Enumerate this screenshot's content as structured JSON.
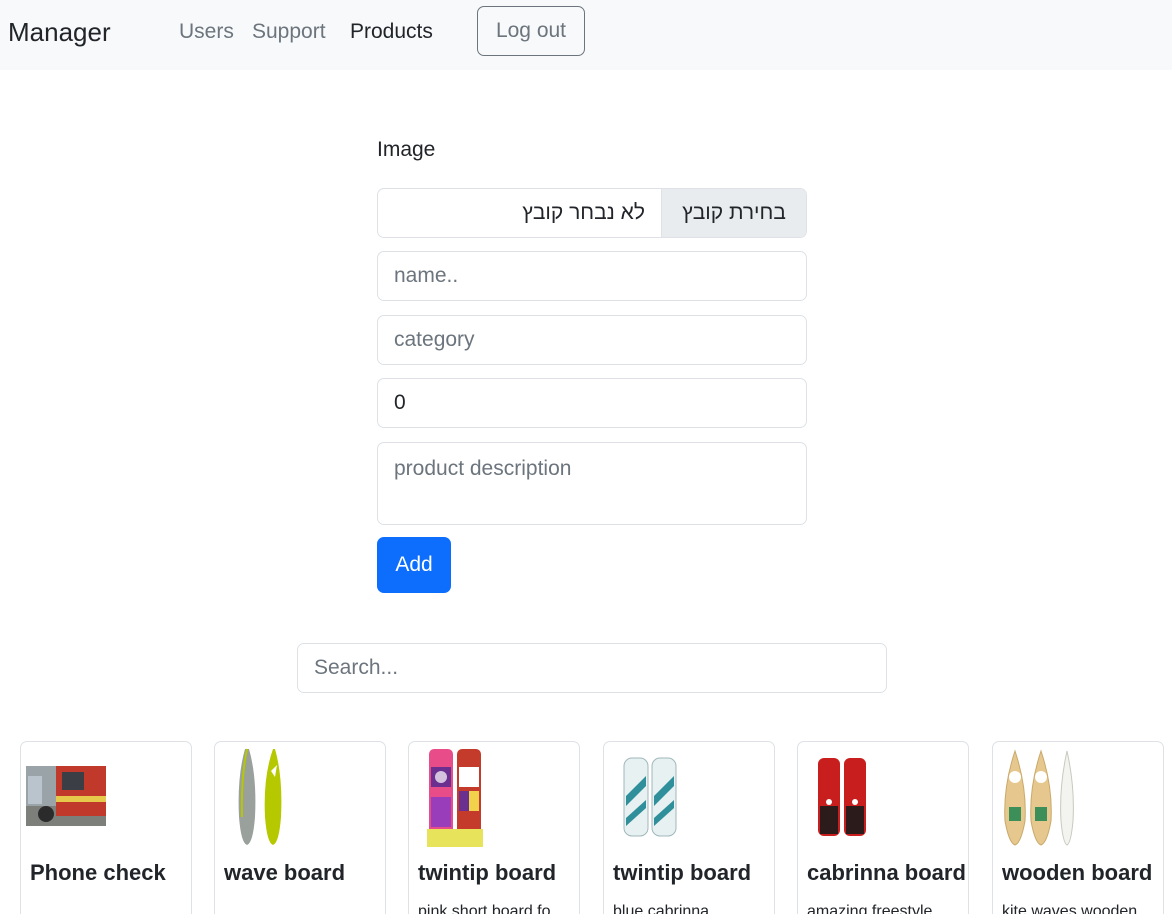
{
  "navbar": {
    "brand": "Manager",
    "links": [
      {
        "label": "Users",
        "active": false
      },
      {
        "label": "Support",
        "active": false
      },
      {
        "label": "Products",
        "active": true
      }
    ],
    "logout_label": "Log out"
  },
  "form": {
    "image_label": "Image",
    "file_button_label": "בחירת קובץ",
    "file_status": "לא נבחר קובץ",
    "name_placeholder": "name..",
    "category_placeholder": "category",
    "price_value": "0",
    "description_placeholder": "product description",
    "add_label": "Add"
  },
  "search": {
    "placeholder": "Search..."
  },
  "products": [
    {
      "title": "Phone check",
      "text": ""
    },
    {
      "title": "wave board",
      "text": ""
    },
    {
      "title": "twintip board",
      "text": "pink short board fo"
    },
    {
      "title": "twintip board",
      "text": "blue cabrinna"
    },
    {
      "title": "cabrinna board",
      "text": "amazing freestyle"
    },
    {
      "title": "wooden board",
      "text": "kite waves wooden"
    }
  ]
}
